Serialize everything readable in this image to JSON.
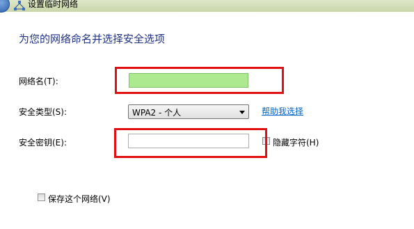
{
  "window": {
    "title": "设置临时网络"
  },
  "main": {
    "heading": "为您的网络命名并选择安全选项"
  },
  "form": {
    "network_name": {
      "label": "网络名(T):",
      "value": ""
    },
    "security_type": {
      "label": "安全类型(S):",
      "selected": "WPA2 - 个人",
      "help_link": "帮助我选择"
    },
    "security_key": {
      "label": "安全密钥(E):",
      "value": "",
      "hide_chars_label": "隐藏字符(H)"
    },
    "save_network": {
      "label": "保存这个网络(V)"
    }
  },
  "colors": {
    "heading": "#1e3287",
    "highlight_field": "#ace98f",
    "annotation_red": "#e01010",
    "link": "#0066cc"
  }
}
